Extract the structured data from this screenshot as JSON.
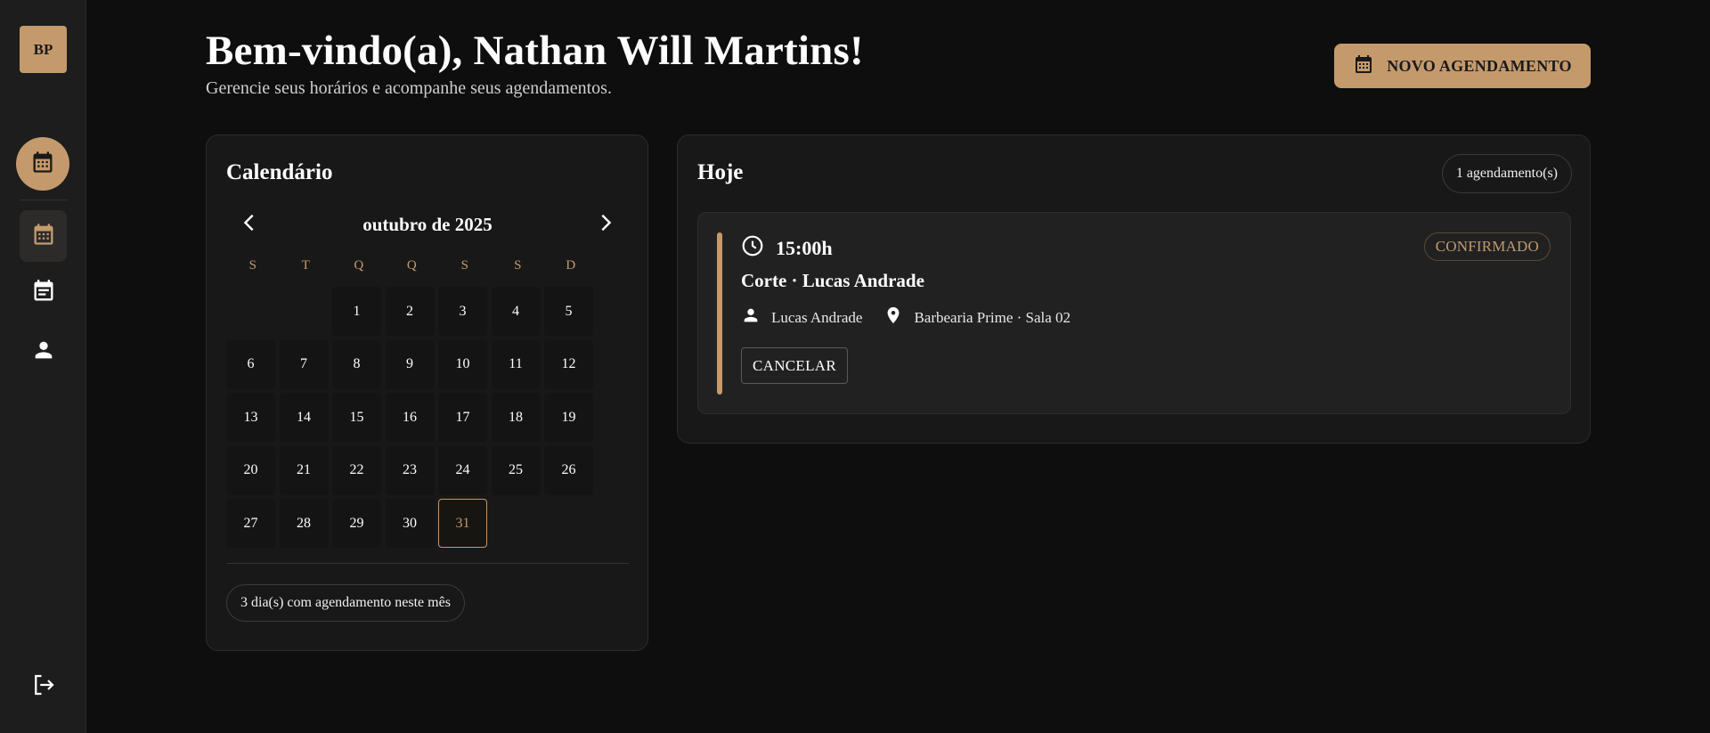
{
  "sidebar": {
    "logo_text": "BP",
    "icons": [
      "calendar-icon",
      "calendar-icon",
      "event-note-icon",
      "person-icon",
      "logout-icon"
    ]
  },
  "header": {
    "title": "Bem-vindo(a), Nathan Will Martins!",
    "subtitle": "Gerencie seus horários e acompanhe seus agendamentos.",
    "new_button_label": "NOVO AGENDAMENTO"
  },
  "calendar": {
    "title": "Calendário",
    "month_label": "outubro de 2025",
    "weekdays": [
      "S",
      "T",
      "Q",
      "Q",
      "S",
      "S",
      "D"
    ],
    "days": [
      "1",
      "2",
      "3",
      "4",
      "5",
      "6",
      "7",
      "8",
      "9",
      "10",
      "11",
      "12",
      "13",
      "14",
      "15",
      "16",
      "17",
      "18",
      "19",
      "20",
      "21",
      "22",
      "23",
      "24",
      "25",
      "26",
      "27",
      "28",
      "29",
      "30",
      "31"
    ],
    "selected_day": "31",
    "summary": "3 dia(s) com agendamento neste mês"
  },
  "today": {
    "title": "Hoje",
    "count_label": "1 agendamento(s)",
    "appointment": {
      "time": "15:00h",
      "status": "CONFIRMADO",
      "title": "Corte · Lucas Andrade",
      "professional": "Lucas Andrade",
      "location": "Barbearia Prime · Sala 02",
      "cancel_label": "CANCELAR"
    }
  },
  "colors": {
    "accent": "#c49a6c",
    "background": "#0e0e0e",
    "card": "#181818",
    "sidebar": "#1d1d1d"
  }
}
